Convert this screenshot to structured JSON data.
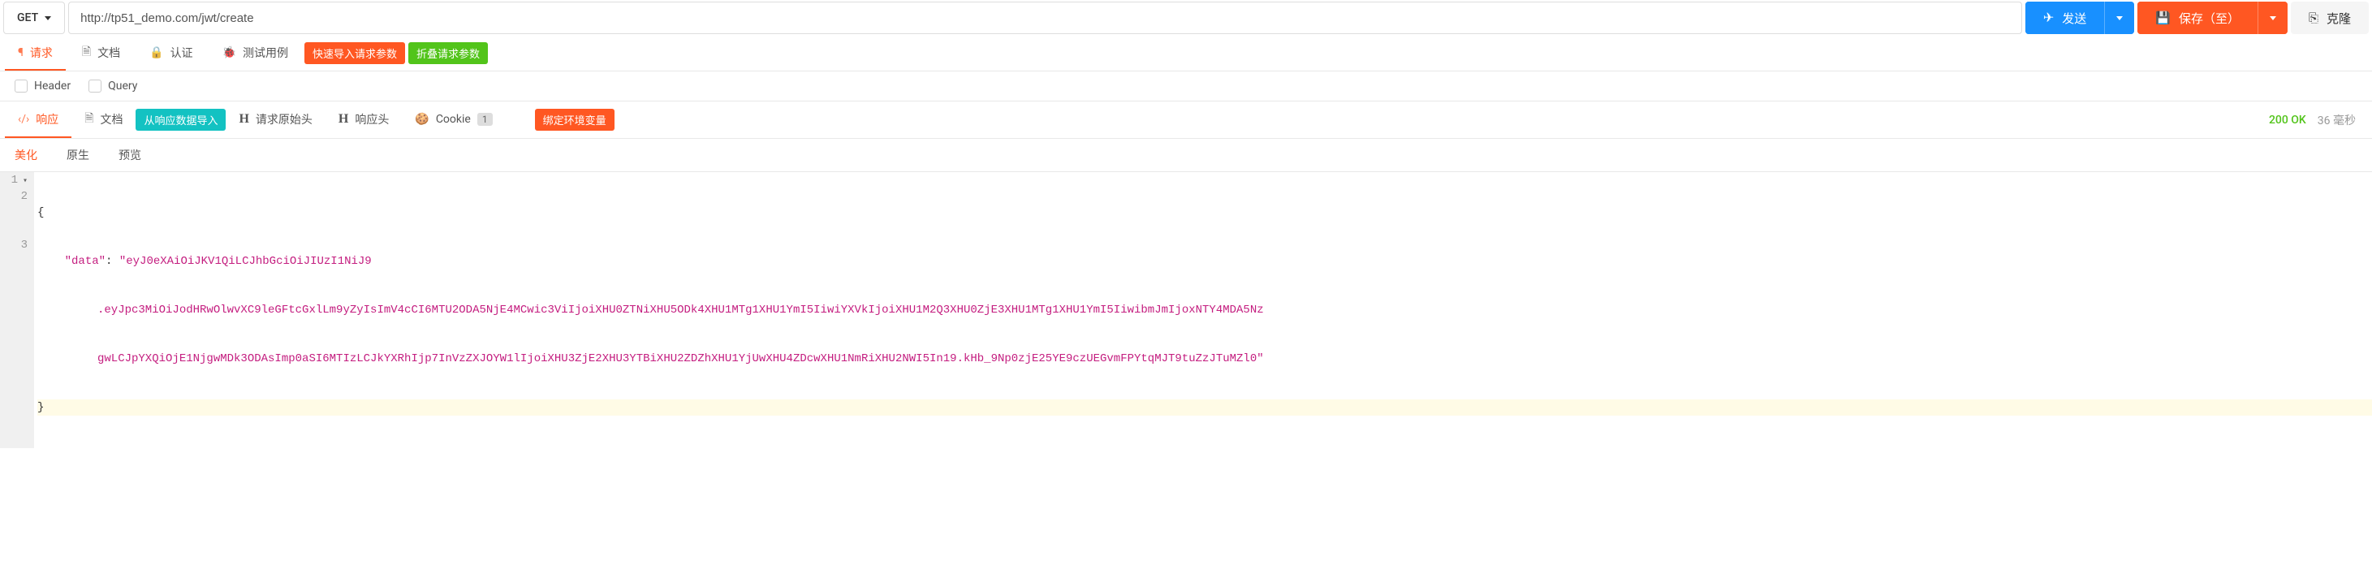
{
  "request": {
    "method": "GET",
    "url": "http://tp51_demo.com/jwt/create",
    "send_label": "发送",
    "save_label": "保存（至）",
    "clone_label": "克隆"
  },
  "req_tabs": {
    "request": "请求",
    "doc": "文档",
    "auth": "认证",
    "testcase": "测试用例",
    "quick_import": "快速导入请求参数",
    "collapse_params": "折叠请求参数"
  },
  "filters": {
    "header": "Header",
    "query": "Query"
  },
  "resp_tabs": {
    "response": "响应",
    "doc": "文档",
    "import_from_resp": "从响应数据导入",
    "raw_header": "请求原始头",
    "response_header": "响应头",
    "cookie": "Cookie",
    "cookie_count": "1",
    "bind_env": "绑定环境变量"
  },
  "resp_status": {
    "code": "200 OK",
    "time": "36 毫秒"
  },
  "views": {
    "beautify": "美化",
    "raw": "原生",
    "preview": "预览"
  },
  "editor": {
    "line_numbers": [
      "1",
      "2",
      "3"
    ],
    "l1": "{",
    "l2_key": "\"data\"",
    "l2_sep": ": ",
    "l2_val_a": "\"eyJ0eXAiOiJKV1QiLCJhbGciOiJIUzI1NiJ9",
    "l2_val_b": ".eyJpc3MiOiJodHRwOlwvXC9leGFtcGxlLm9yZyIsImV4cCI6MTU2ODA5NjE4MCwic3ViIjoiXHU0ZTNiXHU5ODk4XHU1MTg1XHU1YmI5IiwiYXVkIjoiXHU1M2Q3XHU0ZjE3XHU1MTg1XHU1YmI5IiwibmJmIjoxNTY4MDA5Nz",
    "l2_val_c": "gwLCJpYXQiOjE1NjgwMDk3ODAsImp0aSI6MTIzLCJkYXRhIjp7InVzZXJOYW1lIjoiXHU3ZjE2XHU3YTBiXHU2ZDZhXHU1YjUwXHU4ZDcwXHU1NmRiXHU2NWI5In19.kHb_9Np0zjE25YE9czUEGvmFPYtqMJT9tuZzJTuMZl0\"",
    "l3": "}"
  },
  "icons": {
    "h_bold": "H"
  }
}
